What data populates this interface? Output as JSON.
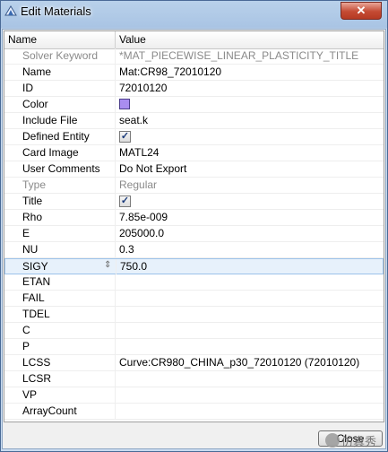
{
  "window": {
    "title": "Edit Materials",
    "close_glyph": "✕"
  },
  "grid": {
    "columns": [
      "Name",
      "Value"
    ],
    "rows": [
      {
        "name": "Solver Keyword",
        "value": "*MAT_PIECEWISE_LINEAR_PLASTICITY_TITLE",
        "kind": "text",
        "grey": true
      },
      {
        "name": "Name",
        "value": "Mat:CR98_72010120",
        "kind": "text"
      },
      {
        "name": "ID",
        "value": "72010120",
        "kind": "text"
      },
      {
        "name": "Color",
        "value": "",
        "kind": "color",
        "color": "#a98df0"
      },
      {
        "name": "Include File",
        "value": "seat.k",
        "kind": "text"
      },
      {
        "name": "Defined Entity",
        "value": "",
        "kind": "check",
        "checked": true
      },
      {
        "name": "Card Image",
        "value": "MATL24",
        "kind": "text"
      },
      {
        "name": "User Comments",
        "value": "Do Not Export",
        "kind": "text"
      },
      {
        "name": "Type",
        "value": "Regular",
        "kind": "text",
        "grey": true
      },
      {
        "name": "Title",
        "value": "",
        "kind": "check",
        "checked": true
      },
      {
        "name": "Rho",
        "value": "7.85e-009",
        "kind": "text"
      },
      {
        "name": "E",
        "value": "205000.0",
        "kind": "text"
      },
      {
        "name": "NU",
        "value": "0.3",
        "kind": "text"
      },
      {
        "name": "SIGY",
        "value": "750.0",
        "kind": "text",
        "selected": true
      },
      {
        "name": "ETAN",
        "value": "",
        "kind": "text"
      },
      {
        "name": "FAIL",
        "value": "",
        "kind": "text"
      },
      {
        "name": "TDEL",
        "value": "",
        "kind": "text"
      },
      {
        "name": "C",
        "value": "",
        "kind": "text"
      },
      {
        "name": "P",
        "value": "",
        "kind": "text"
      },
      {
        "name": "LCSS",
        "value": "Curve:CR980_CHINA_p30_72010120 (72010120)",
        "kind": "text"
      },
      {
        "name": "LCSR",
        "value": "",
        "kind": "text"
      },
      {
        "name": "VP",
        "value": "",
        "kind": "text"
      },
      {
        "name": "ArrayCount",
        "value": "",
        "kind": "text"
      }
    ],
    "check_glyph": "✓",
    "selected_arrow": "⇕"
  },
  "footer": {
    "close_label": "Close"
  },
  "watermark": {
    "text": "仿真秀"
  }
}
